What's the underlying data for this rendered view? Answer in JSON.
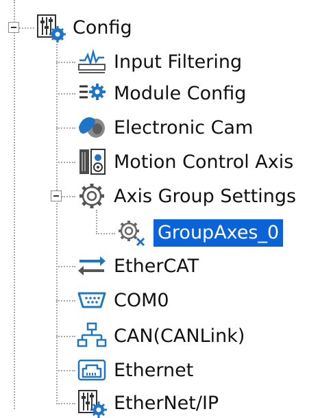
{
  "tree": {
    "root": {
      "label": "Config",
      "icon": "config-sliders-gear-icon"
    },
    "items": [
      {
        "label": "Input Filtering",
        "icon": "input-filter-signal-icon"
      },
      {
        "label": "Module Config",
        "icon": "module-config-gear-list-icon"
      },
      {
        "label": "Electronic Cam",
        "icon": "electronic-cam-icon"
      },
      {
        "label": "Motion Control Axis",
        "icon": "motion-control-axis-icon"
      },
      {
        "label": "Axis Group Settings",
        "icon": "axis-group-gear-icon",
        "children": [
          {
            "label": "GroupAxes_0",
            "icon": "group-axes-gear-icon",
            "selected": true
          }
        ]
      },
      {
        "label": "EtherCAT",
        "icon": "ethercat-arrows-icon"
      },
      {
        "label": "COM0",
        "icon": "serial-port-icon"
      },
      {
        "label": "CAN(CANLink)",
        "icon": "can-network-icon"
      },
      {
        "label": "Ethernet",
        "icon": "ethernet-port-icon"
      },
      {
        "label": "EtherNet/IP",
        "icon": "ethernet-ip-sliders-icon"
      }
    ]
  },
  "colors": {
    "selection_bg": "#0a64d8",
    "selection_text": "#ffffff",
    "icon_blue": "#1e74c6",
    "connector": "#a8a8a8"
  }
}
